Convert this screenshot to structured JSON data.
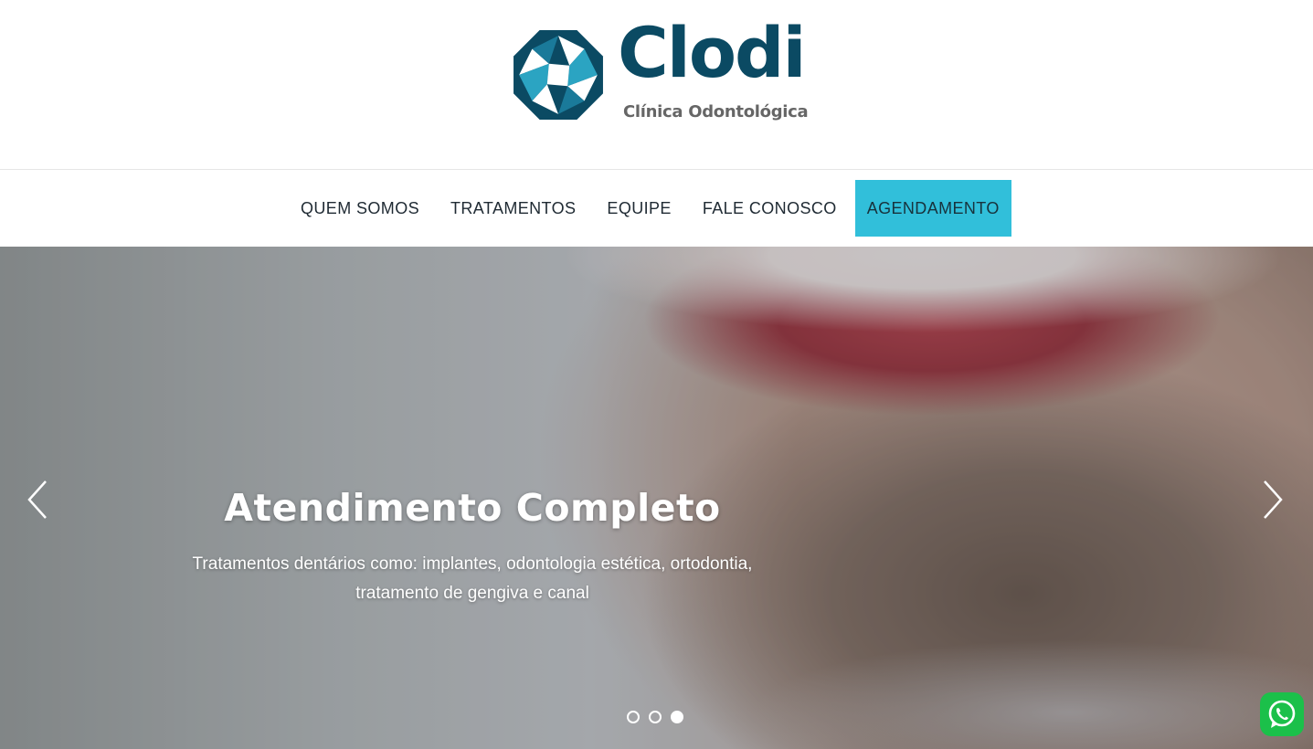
{
  "brand": {
    "name": "Clodi",
    "subtitle": "Clínica Odontológica",
    "colors": {
      "dark_teal": "#0b4a63",
      "light_teal": "#31bfda",
      "grey": "#666666"
    }
  },
  "nav": {
    "items": [
      {
        "label": "QUEM SOMOS"
      },
      {
        "label": "TRATAMENTOS"
      },
      {
        "label": "EQUIPE"
      },
      {
        "label": "FALE CONOSCO"
      },
      {
        "label": "AGENDAMENTO",
        "active": true
      }
    ],
    "active_color": "#31bfda"
  },
  "slider": {
    "title": "Atendimento Completo",
    "description_line1": "Tratamentos dentários como: implantes, odontologia estética, ortodontia,",
    "description_line2": "tratamento de gengiva e canal",
    "prev_icon": "chevron-left-icon",
    "next_icon": "chevron-right-icon",
    "slide_count": 3,
    "active_slide": 3
  },
  "whatsapp": {
    "icon": "whatsapp-icon",
    "color": "#1bc04a"
  }
}
